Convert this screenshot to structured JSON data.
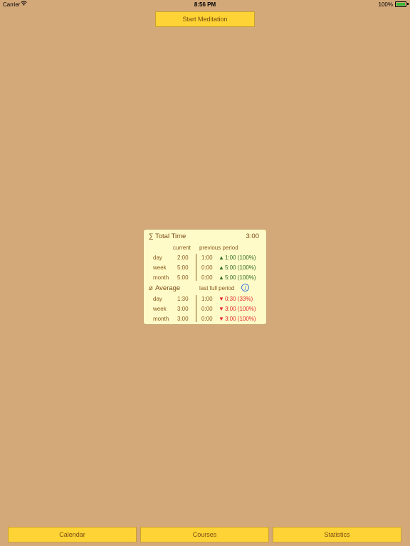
{
  "status_bar": {
    "carrier": "Carrier",
    "time": "8:56 PM",
    "battery": "100%"
  },
  "start_button": "Start Meditation",
  "stats": {
    "total": {
      "symbol": "∑",
      "title": "Total Time",
      "value": "3:00",
      "col_current": "current",
      "col_previous": "previous period",
      "rows": [
        {
          "label": "day",
          "current": "2:00",
          "previous": "1:00",
          "arrow": "▲",
          "change": "1:00 (100%)"
        },
        {
          "label": "week",
          "current": "5:00",
          "previous": "0:00",
          "arrow": "▲",
          "change": "5:00 (100%)"
        },
        {
          "label": "month",
          "current": "5:00",
          "previous": "0:00",
          "arrow": "▲",
          "change": "5:00 (100%)"
        }
      ]
    },
    "average": {
      "symbol": "⌀",
      "title": "Average",
      "col_previous": "last full period",
      "info_icon": "i",
      "rows": [
        {
          "label": "day",
          "current": "1:30",
          "previous": "1:00",
          "arrow": "▼",
          "change": "0:30 (33%)"
        },
        {
          "label": "week",
          "current": "3:00",
          "previous": "0:00",
          "arrow": "▼",
          "change": "3:00 (100%)"
        },
        {
          "label": "month",
          "current": "3:00",
          "previous": "0:00",
          "arrow": "▼",
          "change": "3:00 (100%)"
        }
      ]
    }
  },
  "tabs": {
    "calendar": "Calendar",
    "courses": "Courses",
    "statistics": "Statistics"
  },
  "colors": {
    "background": "#d4a97a",
    "button": "#fdd335",
    "card": "#fffbc9",
    "positive": "#2f6b1f",
    "negative": "#e0282a"
  }
}
